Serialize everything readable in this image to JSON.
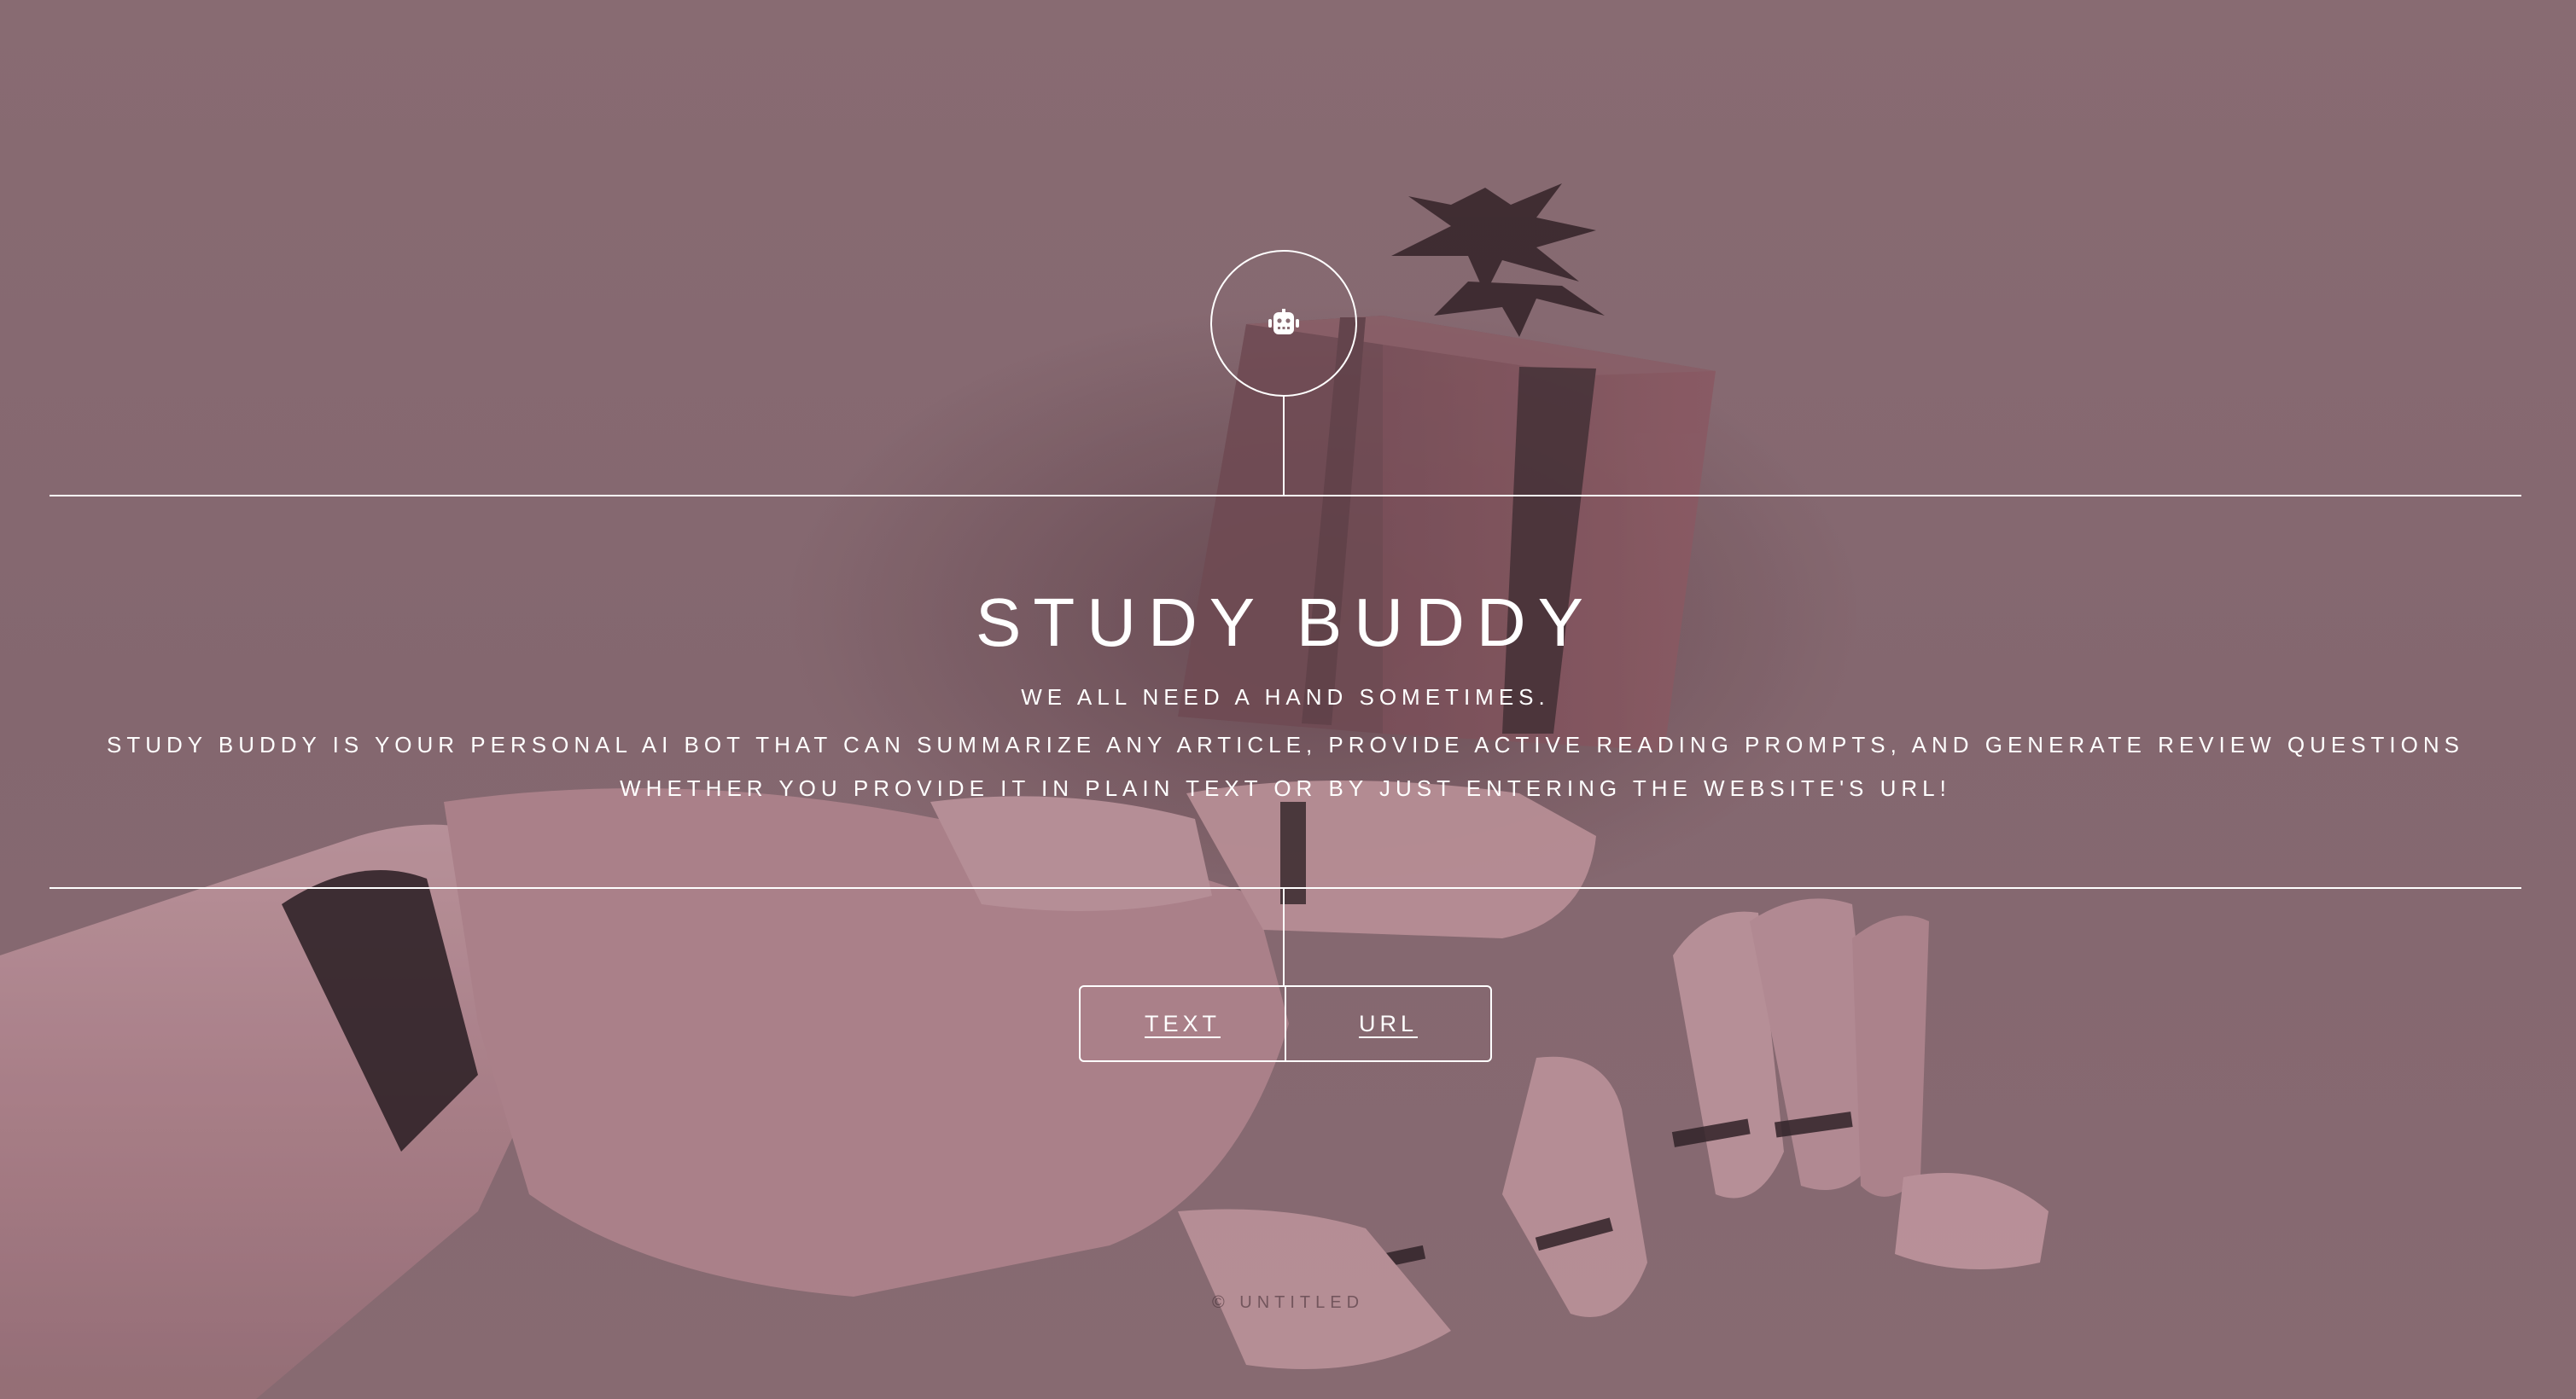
{
  "header": {
    "logo_icon": "robot-icon"
  },
  "hero": {
    "title": "STUDY BUDDY",
    "tagline": "WE ALL NEED A HAND SOMETIMES.",
    "description_line1": "STUDY BUDDY IS YOUR PERSONAL AI BOT THAT CAN SUMMARIZE ANY ARTICLE, PROVIDE ACTIVE READING PROMPTS, AND GENERATE REVIEW QUESTIONS",
    "description_line2": "WHETHER YOU PROVIDE IT IN PLAIN TEXT OR BY JUST ENTERING THE WEBSITE'S URL!"
  },
  "toggle": {
    "text_label": "TEXT",
    "url_label": "URL"
  },
  "footer": {
    "text": "© UNTITLED"
  },
  "colors": {
    "background": "#8a6e75",
    "foreground": "#ffffff"
  }
}
